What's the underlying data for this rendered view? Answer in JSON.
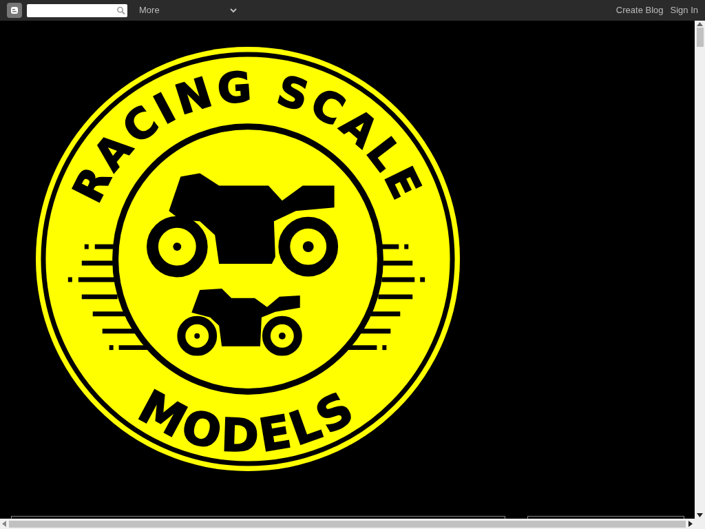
{
  "navbar": {
    "more_menu": "More",
    "links": [
      "Create Blog",
      "Sign In"
    ]
  },
  "header_logo": {
    "top_text": "RACING SCALE",
    "bottom_text": "MODELS"
  }
}
